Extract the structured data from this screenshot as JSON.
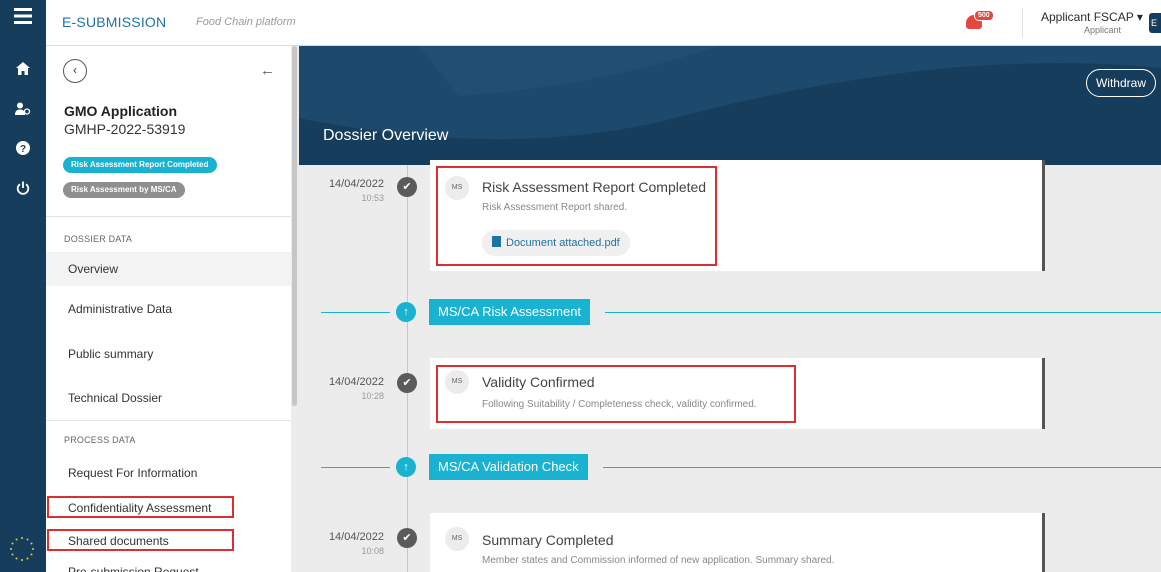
{
  "app": {
    "brand": "E-SUBMISSION",
    "brand_sub": "Food Chain platform"
  },
  "header": {
    "notification_count": "500",
    "user_name": "Applicant FSCAP ▾",
    "user_role": "Applicant",
    "avatar_letter": "E"
  },
  "rail": {
    "items": [
      "home-icon",
      "users-icon",
      "help-icon",
      "power-icon"
    ]
  },
  "sidebar": {
    "back_glyph": "‹",
    "collapse_glyph": "←",
    "title": "GMO Application",
    "application_id": "GMHP-2022-53919",
    "statuses": [
      "Risk Assessment Report Completed",
      "Risk Assessment by MS/CA"
    ],
    "dossier_section": "DOSSIER DATA",
    "dossier_items": [
      "Overview",
      "Administrative Data",
      "Public summary",
      "Technical Dossier"
    ],
    "process_section": "PROCESS DATA",
    "process_items": [
      "Request For Information",
      "Confidentiality Assessment",
      "Shared documents",
      "Pre-submission Request"
    ]
  },
  "main": {
    "title": "Dossier Overview",
    "withdraw_label": "Withdraw",
    "events": [
      {
        "date": "14/04/2022",
        "time": "10:53",
        "badge": "MS",
        "title": "Risk Assessment Report Completed",
        "description": "Risk Assessment Report shared.",
        "attachment": "Document attached.pdf"
      },
      {
        "date": "14/04/2022",
        "time": "10:28",
        "badge": "MS",
        "title": "Validity Confirmed",
        "description": "Following Suitability / Completeness check, validity confirmed."
      },
      {
        "date": "14/04/2022",
        "time": "10:08",
        "badge": "MS",
        "title": "Summary Completed",
        "description": "Member states and Commission informed of new application. Summary shared."
      }
    ],
    "phases": [
      "MS/CA Risk Assessment",
      "MS/CA Validation Check"
    ]
  },
  "colors": {
    "navy": "#173d5c",
    "accent": "#19b3d1",
    "highlight": "#d9302f",
    "link": "#1f72a6"
  }
}
